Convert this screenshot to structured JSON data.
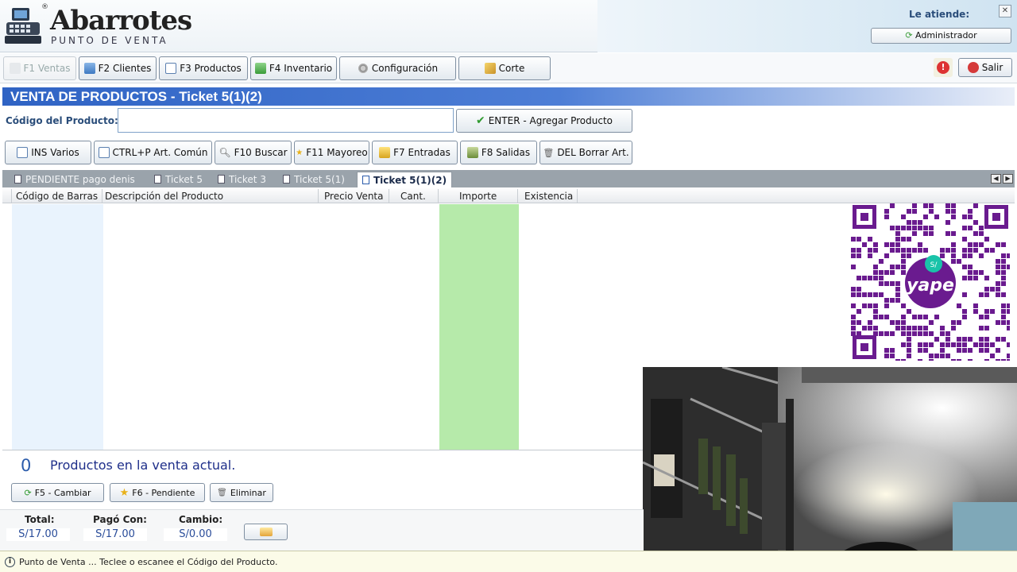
{
  "app": {
    "logo_title": "Abarrotes",
    "logo_subtitle": "PUNTO DE VENTA",
    "logo_mark": "®"
  },
  "user": {
    "label": "Le atiende:",
    "name": "Administrador"
  },
  "nav": [
    {
      "label": "F1 Ventas",
      "icon": "cart-icon",
      "disabled": true
    },
    {
      "label": "F2 Clientes",
      "icon": "users-icon"
    },
    {
      "label": "F3 Productos",
      "icon": "products-icon"
    },
    {
      "label": "F4 Inventario",
      "icon": "inventory-icon"
    },
    {
      "label": "Configuración",
      "icon": "gear-icon"
    },
    {
      "label": "Corte",
      "icon": "report-icon"
    }
  ],
  "exit_label": "Salir",
  "title": "VENTA DE PRODUCTOS - Ticket 5(1)(2)",
  "code": {
    "label": "Código del Producto:",
    "value": "",
    "add_label": "ENTER - Agregar Producto"
  },
  "actions": [
    {
      "label": "INS Varios"
    },
    {
      "label": "CTRL+P Art. Común"
    },
    {
      "label": "F10 Buscar"
    },
    {
      "label": "F11 Mayoreo"
    },
    {
      "label": "F7 Entradas"
    },
    {
      "label": "F8 Salidas"
    },
    {
      "label": "DEL Borrar Art."
    }
  ],
  "tabs": [
    {
      "label": "PENDIENTE pago denis",
      "active": false
    },
    {
      "label": "Ticket 5",
      "active": false
    },
    {
      "label": "Ticket 3",
      "active": false
    },
    {
      "label": "Ticket 5(1)",
      "active": false
    },
    {
      "label": "Ticket 5(1)(2)",
      "active": true
    }
  ],
  "columns": [
    "Código de Barras",
    "Descripción del Producto",
    "Precio Venta",
    "Cant.",
    "Importe",
    "Existencia"
  ],
  "rows": [],
  "summary": {
    "count": "0",
    "count_label": "Productos en la venta actual."
  },
  "ticket_actions": [
    {
      "label": "F5 - Cambiar"
    },
    {
      "label": "F6 - Pendiente"
    },
    {
      "label": "Eliminar"
    }
  ],
  "totals": {
    "total_label": "Total:",
    "total": "S/17.00",
    "paid_label": "Pagó Con:",
    "paid": "S/17.00",
    "change_label": "Cambio:",
    "change": "S/0.00"
  },
  "status": "Punto de Venta ... Teclee o escanee el Código del Producto.",
  "qr_brand": "yape",
  "qr_symbol": "S/"
}
